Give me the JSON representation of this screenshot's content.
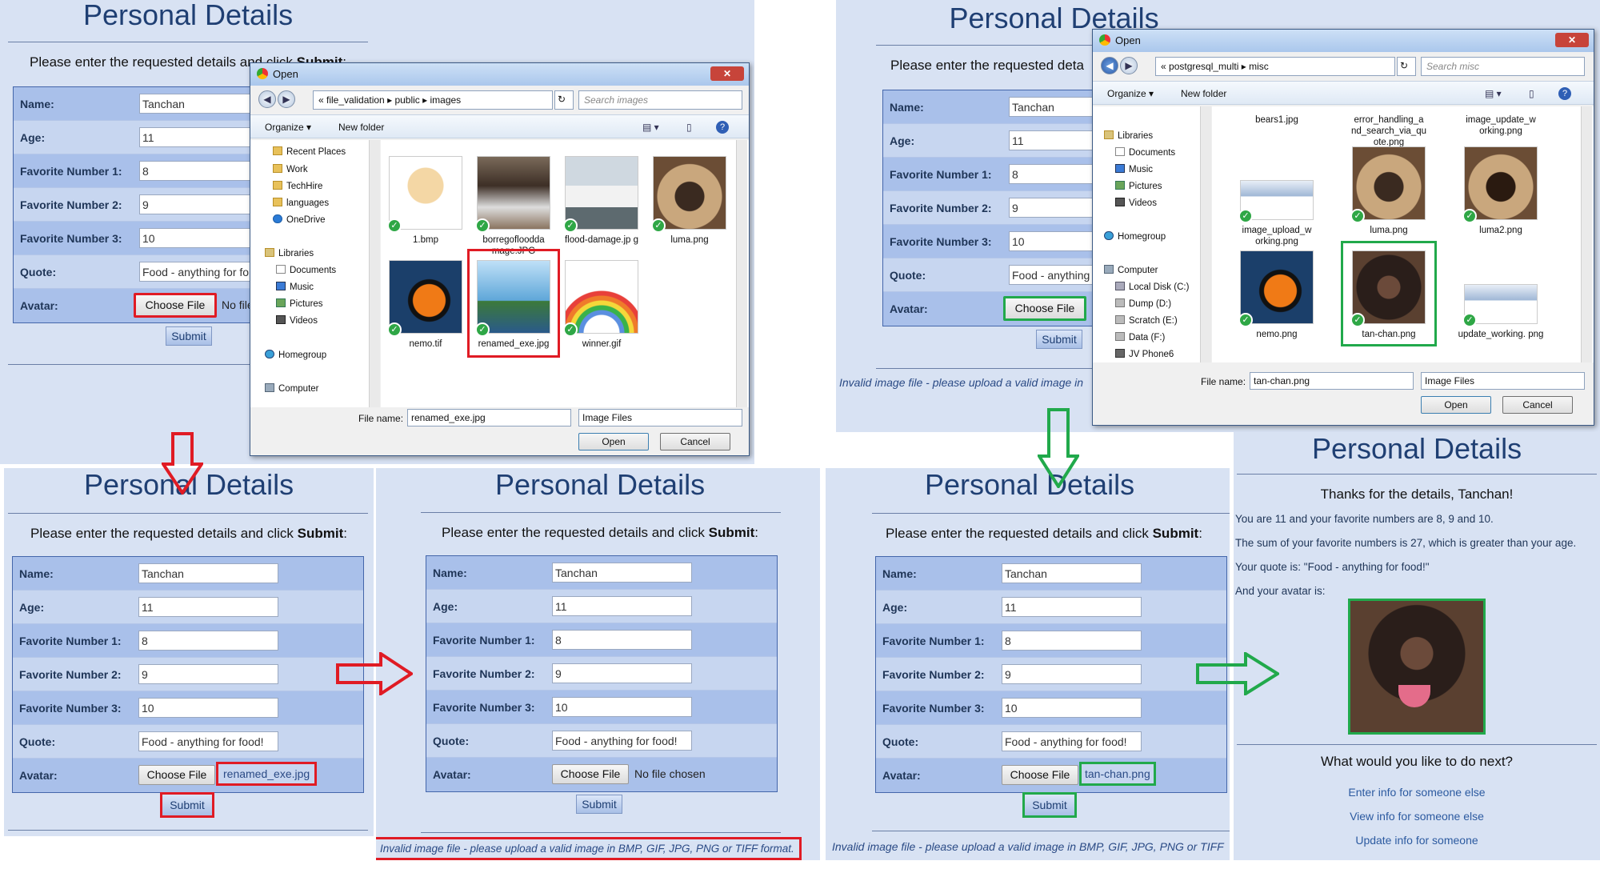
{
  "form": {
    "title": "Personal Details",
    "instruction_prefix": "Please enter the requested details and click ",
    "instruction_bold": "Submit",
    "instruction_suffix": ":",
    "labels": {
      "name": "Name:",
      "age": "Age:",
      "fav1": "Favorite Number 1:",
      "fav2": "Favorite Number 2:",
      "fav3": "Favorite Number 3:",
      "quote": "Quote:",
      "avatar": "Avatar:"
    },
    "values": {
      "name": "Tanchan",
      "age": "11",
      "fav1": "8",
      "fav2": "9",
      "fav3": "10",
      "quote": "Food - anything for food!"
    },
    "choose_file": "Choose File",
    "no_file": "No file chosen",
    "submit": "Submit",
    "invalid_msg": "Invalid image file - please upload a valid image in BMP, GIF, JPG, PNG or TIFF format."
  },
  "panel_topleft": {
    "quote_value": "Food - anything for fo",
    "no_file_partial": "No file"
  },
  "panel_topright": {
    "instruction_partial": "Please enter the requested deta",
    "quote_value": "Food - anything",
    "invalid_partial": "Invalid image file - please upload a valid image in"
  },
  "dialog_left": {
    "title": "Open",
    "path": [
      "file_validation",
      "public",
      "images"
    ],
    "search_placeholder": "Search images",
    "organize": "Organize ▾",
    "new_folder": "New folder",
    "nav": [
      "Recent Places",
      "Work",
      "TechHire",
      "languages",
      "OneDrive",
      "Libraries",
      "Documents",
      "Music",
      "Pictures",
      "Videos",
      "Homegroup",
      "Computer"
    ],
    "files": [
      "1.bmp",
      "borregofloodda mage.JPG",
      "flood-damage.jp g",
      "luma.png",
      "nemo.tif",
      "renamed_exe.jpg",
      "winner.gif"
    ],
    "filename_label": "File name:",
    "filename_value": "renamed_exe.jpg",
    "filetype": "Image Files",
    "open": "Open",
    "cancel": "Cancel"
  },
  "dialog_right": {
    "title": "Open",
    "path": [
      "postgresql_multi",
      "misc"
    ],
    "search_placeholder": "Search misc",
    "organize": "Organize ▾",
    "new_folder": "New folder",
    "nav": [
      "Libraries",
      "Documents",
      "Music",
      "Pictures",
      "Videos",
      "Homegroup",
      "Computer",
      "Local Disk (C:)",
      "Dump (D:)",
      "Scratch (E:)",
      "Data (F:)",
      "JV Phone6"
    ],
    "files_top": [
      "bears1.jpg",
      "error_handling_a nd_search_via_qu ote.png",
      "image_update_w orking.png"
    ],
    "files": [
      "image_upload_w orking.png",
      "luma.png",
      "luma2.png",
      "nemo.png",
      "tan-chan.png",
      "update_working. png"
    ],
    "filename_label": "File name:",
    "filename_value": "tan-chan.png",
    "filetype": "Image Files",
    "open": "Open",
    "cancel": "Cancel"
  },
  "result_red": {
    "file_chosen": "renamed_exe.jpg"
  },
  "result_green": {
    "file_chosen": "tan-chan.png",
    "invalid_partial": "Invalid image file - please upload a valid image in BMP, GIF, JPG, PNG or TIFF"
  },
  "success": {
    "title": "Personal Details",
    "thanks": "Thanks for the details, Tanchan!",
    "line1": "You are 11 and your favorite numbers are 8, 9 and 10.",
    "line2": "The sum of your favorite numbers is 27, which is greater than your age.",
    "line3": "Your quote is: \"Food - anything for food!\"",
    "line4": "And your avatar is:",
    "next": "What would you like to do next?",
    "links": [
      "Enter info for someone else",
      "View info for someone else",
      "Update info for someone"
    ]
  },
  "colors": {
    "bad": "#e01b24",
    "good": "#21a94b",
    "panel": "#d8e2f3",
    "title": "#1f3f73"
  }
}
